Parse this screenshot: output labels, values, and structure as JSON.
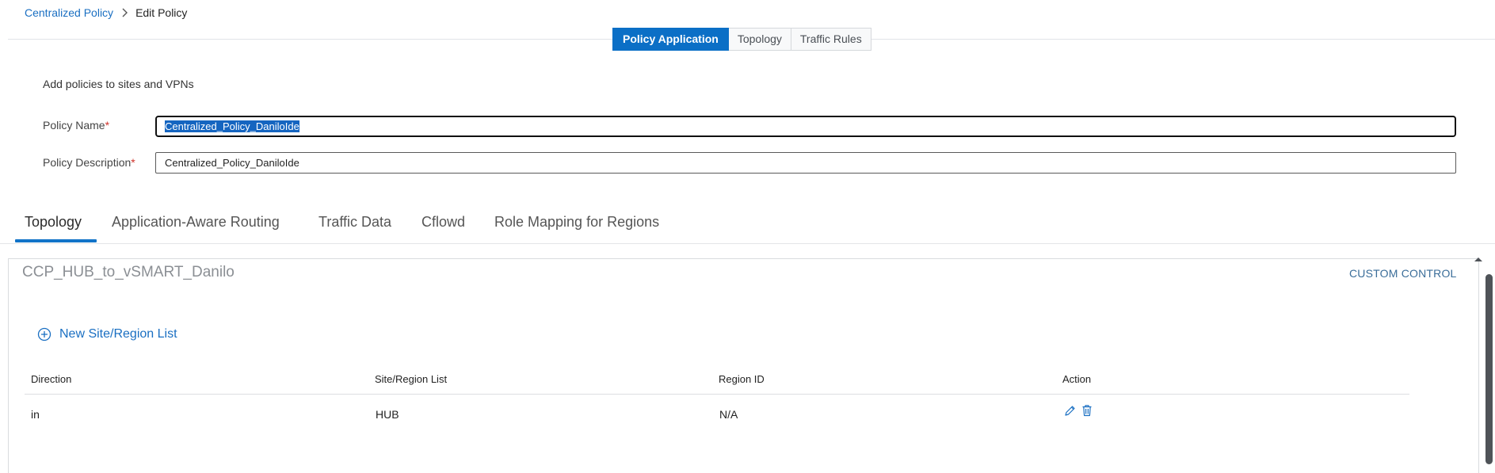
{
  "breadcrumb": {
    "parent": "Centralized Policy",
    "current": "Edit Policy"
  },
  "step_tabs": [
    {
      "label": "Policy Application",
      "active": true
    },
    {
      "label": "Topology",
      "active": false
    },
    {
      "label": "Traffic Rules",
      "active": false
    }
  ],
  "form": {
    "description": "Add policies to sites and VPNs",
    "policy_name": {
      "label": "Policy Name",
      "required_mark": "*",
      "value": "Centralized_Policy_DaniloIde"
    },
    "policy_description": {
      "label": "Policy Description",
      "required_mark": "*",
      "value": "Centralized_Policy_DaniloIde"
    }
  },
  "section_tabs": [
    {
      "label": "Topology",
      "active": true
    },
    {
      "label": "Application-Aware Routing",
      "active": false
    },
    {
      "label": "Traffic Data",
      "active": false
    },
    {
      "label": "Cflowd",
      "active": false
    },
    {
      "label": "Role Mapping for Regions",
      "active": false
    }
  ],
  "card": {
    "title": "CCP_HUB_to_vSMART_Danilo",
    "type_label": "CUSTOM CONTROL",
    "new_list_label": "New Site/Region List",
    "table": {
      "headers": [
        "Direction",
        "Site/Region List",
        "Region ID",
        "Action"
      ],
      "rows": [
        {
          "direction": "in",
          "site_region_list": "HUB",
          "region_id": "N/A"
        }
      ]
    }
  },
  "icons": {
    "breadcrumb_separator": "chevron-right-icon",
    "new_list": "plus-circle-icon",
    "edit": "pencil-icon",
    "delete": "trash-icon",
    "scroll_up": "arrow-up-icon"
  },
  "colors": {
    "accent": "#0b6fc6",
    "link": "#1a6fc2",
    "required": "#d0342c",
    "muted_title": "#8b8f94"
  }
}
